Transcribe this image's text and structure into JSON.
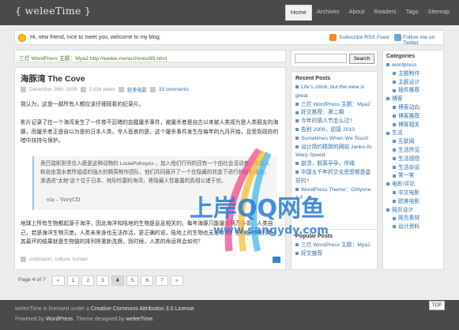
{
  "site": {
    "logo": "{ weleeTime }"
  },
  "nav": [
    "Home",
    "Archives",
    "About",
    "Readers",
    "Tags",
    "Sitemap"
  ],
  "notice": {
    "message": "Hi, new friend, nice to meet you, welcome to my blog.",
    "rss": "Subscribe RSS Feed",
    "twitter": "Follow me on Twitter"
  },
  "related": "三烂 WordPress 主题：Mya2 http://welee.me/archives/85.html",
  "post": {
    "title": "海豚湾 The Cove",
    "date": "December 26th, 2009",
    "views": "2,416 views",
    "category": "获美电影",
    "comments": "33 comments",
    "p1": "我认为，这是一部所有人都应该仔细观看的纪录片。",
    "p2": "影片记录了在一个海湾发生了一件惨不忍睹的血腥屠杀事件，被屠杀者是自古以来被人类视为是人类朋友的海豚，而屠杀者正是自以为是的日本人类，令人悲哀的是，这个屠杀事件发生在每年的九月开始，且受到政府的暗中扶持与保护。",
    "quote": "奥巴瑞斯则坚信入鹿是这种动物的 LouiePsihoyos ，加入他们行列的还有一个由社会活动者、电影人和自由潜水者所组成的强大的精英制作团队，他们共同展开了一个在隐藏的状态下进行的偷拍任务，渗透进\"太地\"这个位于日本、地形险要的海湾，将隐藏人性暴露的真相公诸于世。",
    "quote_attr": "via – VeryCD",
    "p3": "地球上所有生物都起源于海洋，因此海洋和陆地的生物是息息相关的。每年海豚只能屠杀两万多条，人类自己，若是海洋生物灭绝，人类未来身也无法存活，更正确的说，陆地上的生物也无法存活。生物链若被打断，其最坏的结果就是生物链的排列将重新洗牌，到时候，人类的命运将会如何？",
    "tags": "civilization, culture, human"
  },
  "pager": {
    "label": "Page 4 of 7",
    "pages": [
      "«",
      "1",
      "2",
      "3",
      "4",
      "5",
      "6",
      "7",
      "»"
    ],
    "current": "4"
  },
  "search": {
    "placeholder": "",
    "button": "Search"
  },
  "recent": {
    "title": "Recent Posts",
    "items": [
      "Life's climb, but the view is great",
      "三烂 WordPress 主题：Mya2",
      "好文推荐：第二期",
      "今年的猜人节怎么过?",
      "告别 2009，迎接 2010",
      "Sometimes When We Touch",
      "设计简约精致的网站 Janko At Warp Speed",
      "崩溃，脱离孕孕，伴绳",
      "中国五千年的文化思想都是虚好的?",
      "WordPress Theme：Onlyone 1.0"
    ]
  },
  "popular": {
    "title": "Popular Posts",
    "items": [
      "三烂 WordPress 主题：Mya2",
      "好文推荐"
    ]
  },
  "categories": {
    "title": "Categories",
    "items": [
      {
        "label": "wordpress",
        "sub": false
      },
      {
        "label": "主题制作",
        "sub": true
      },
      {
        "label": "主题设计",
        "sub": true
      },
      {
        "label": "插件推荐",
        "sub": true
      },
      {
        "label": "博客",
        "sub": false
      },
      {
        "label": "博客动向",
        "sub": true
      },
      {
        "label": "博客推荐",
        "sub": true
      },
      {
        "label": "博客相关",
        "sub": true
      },
      {
        "label": "生活",
        "sub": false
      },
      {
        "label": "互联网",
        "sub": true
      },
      {
        "label": "生活所见",
        "sub": true
      },
      {
        "label": "生活感悟",
        "sub": true
      },
      {
        "label": "生活杂谈",
        "sub": true
      },
      {
        "label": "笑一笑",
        "sub": true
      },
      {
        "label": "电影/评论",
        "sub": false
      },
      {
        "label": "中文电影",
        "sub": true
      },
      {
        "label": "欧美电影",
        "sub": true
      },
      {
        "label": "网页设计",
        "sub": false
      },
      {
        "label": "网页素材",
        "sub": true
      },
      {
        "label": "设计资料",
        "sub": true
      }
    ]
  },
  "footer": {
    "line1_a": "weleeTime",
    "line1_b": " is licensed under a ",
    "line1_link": "Creative Commons Attribution 3.0 License",
    "line1_c": ".",
    "line2_a": "Powered by ",
    "line2_wp": "WordPress",
    "line2_b": ". Theme designed by ",
    "line2_author": "weleeTime",
    "line2_c": "."
  },
  "top": "TOP",
  "watermark": {
    "line1": "上岸QQ网鱼",
    "line2": "www.sangydy.com"
  }
}
